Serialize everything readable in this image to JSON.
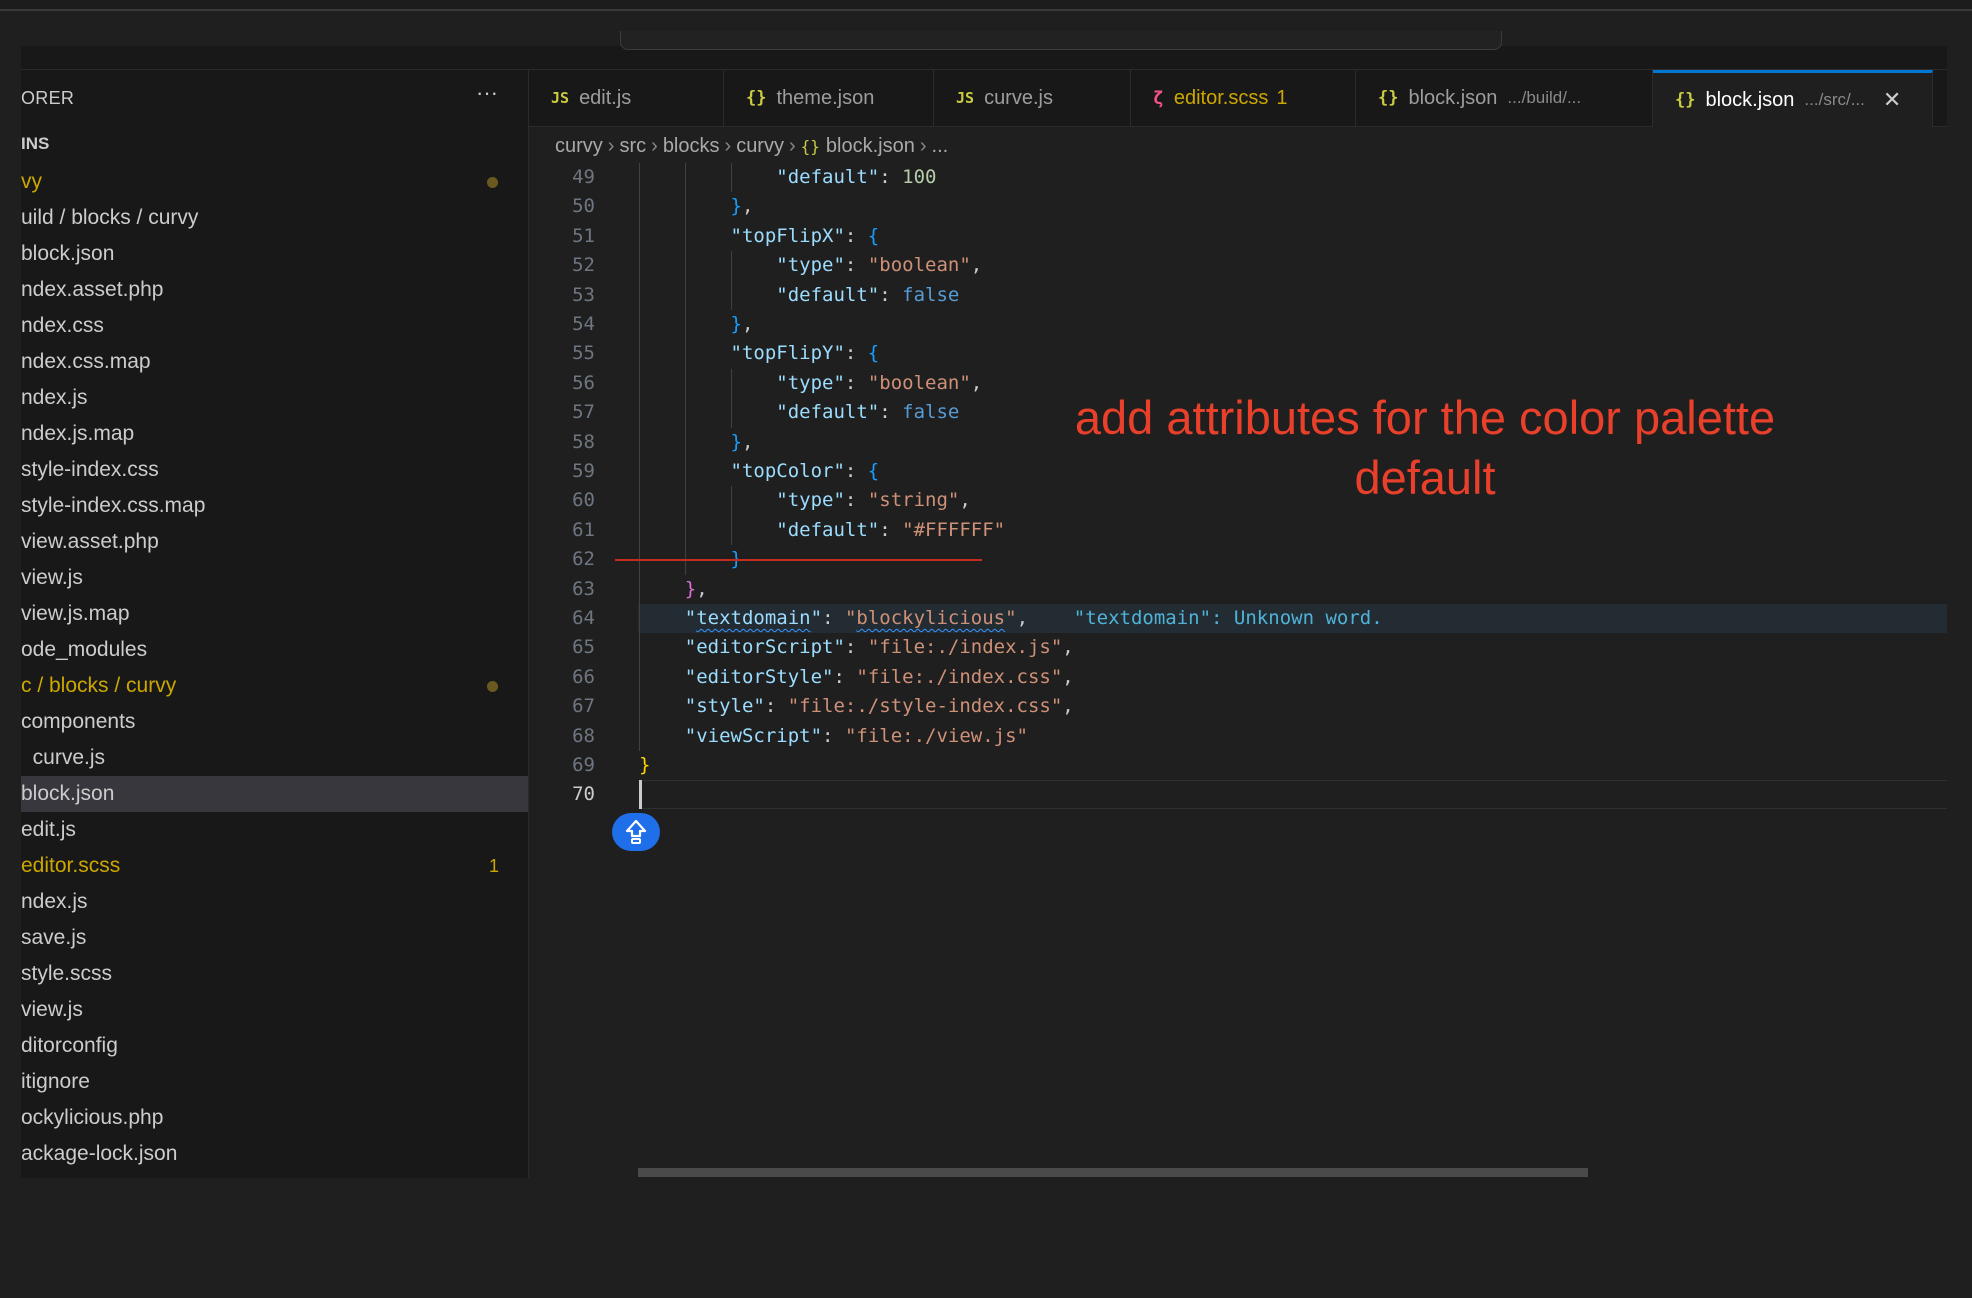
{
  "colors": {
    "accent": "#0078d4",
    "annotation": "#e8402a",
    "modified": "#cca700"
  },
  "sidebar": {
    "title": "ORER",
    "more_icon": "ellipsis-icon",
    "section": "INS",
    "items": [
      {
        "label": "vy",
        "modified": true,
        "dot": true
      },
      {
        "label": "uild / blocks / curvy"
      },
      {
        "label": "block.json"
      },
      {
        "label": "ndex.asset.php"
      },
      {
        "label": "ndex.css"
      },
      {
        "label": "ndex.css.map"
      },
      {
        "label": "ndex.js"
      },
      {
        "label": "ndex.js.map"
      },
      {
        "label": "style-index.css"
      },
      {
        "label": "style-index.css.map"
      },
      {
        "label": "view.asset.php"
      },
      {
        "label": "view.js"
      },
      {
        "label": "view.js.map"
      },
      {
        "label": "ode_modules"
      },
      {
        "label": "c / blocks / curvy",
        "modified": true,
        "dot": true
      },
      {
        "label": "components"
      },
      {
        "label": "  curve.js"
      },
      {
        "label": "block.json",
        "selected": true
      },
      {
        "label": "edit.js"
      },
      {
        "label": "editor.scss",
        "modified": true,
        "badge": "1"
      },
      {
        "label": "ndex.js"
      },
      {
        "label": "save.js"
      },
      {
        "label": "style.scss"
      },
      {
        "label": "view.js"
      },
      {
        "label": "ditorconfig"
      },
      {
        "label": "itignore"
      },
      {
        "label": "ockylicious.php"
      },
      {
        "label": "ackage-lock.json"
      }
    ]
  },
  "tabs": [
    {
      "icon": "JS",
      "kind": "js",
      "label": "edit.js"
    },
    {
      "icon": "{}",
      "kind": "json",
      "label": "theme.json"
    },
    {
      "icon": "JS",
      "kind": "js",
      "label": "curve.js"
    },
    {
      "icon": "sass-icon",
      "kind": "scss",
      "label": "editor.scss",
      "errors": "1"
    },
    {
      "icon": "{}",
      "kind": "json",
      "label": "block.json",
      "desc": ".../build/..."
    },
    {
      "icon": "{}",
      "kind": "json",
      "label": "block.json",
      "desc": ".../src/...",
      "active": true
    }
  ],
  "breadcrumb": [
    "curvy",
    "src",
    "blocks",
    "curvy",
    "block.json",
    "..."
  ],
  "annotation": {
    "line1": "add attributes for the color palette",
    "line2": "default"
  },
  "code": {
    "cursor_line": 70,
    "highlight_line": 64,
    "lines": [
      {
        "n": "49",
        "tokens": [
          [
            "            ",
            "p"
          ],
          [
            "\"default\"",
            "key"
          ],
          [
            ": ",
            "p"
          ],
          [
            "100",
            "num"
          ]
        ]
      },
      {
        "n": "50",
        "tokens": [
          [
            "        ",
            "p"
          ],
          [
            "}",
            "b3"
          ],
          [
            ",",
            "p"
          ]
        ]
      },
      {
        "n": "51",
        "tokens": [
          [
            "        ",
            "p"
          ],
          [
            "\"topFlipX\"",
            "key"
          ],
          [
            ": ",
            "p"
          ],
          [
            "{",
            "b3"
          ]
        ]
      },
      {
        "n": "52",
        "tokens": [
          [
            "            ",
            "p"
          ],
          [
            "\"type\"",
            "key"
          ],
          [
            ": ",
            "p"
          ],
          [
            "\"boolean\"",
            "str"
          ],
          [
            ",",
            "p"
          ]
        ]
      },
      {
        "n": "53",
        "tokens": [
          [
            "            ",
            "p"
          ],
          [
            "\"default\"",
            "key"
          ],
          [
            ": ",
            "p"
          ],
          [
            "false",
            "bool"
          ]
        ]
      },
      {
        "n": "54",
        "tokens": [
          [
            "        ",
            "p"
          ],
          [
            "}",
            "b3"
          ],
          [
            ",",
            "p"
          ]
        ]
      },
      {
        "n": "55",
        "tokens": [
          [
            "        ",
            "p"
          ],
          [
            "\"topFlipY\"",
            "key"
          ],
          [
            ": ",
            "p"
          ],
          [
            "{",
            "b3"
          ]
        ]
      },
      {
        "n": "56",
        "tokens": [
          [
            "            ",
            "p"
          ],
          [
            "\"type\"",
            "key"
          ],
          [
            ": ",
            "p"
          ],
          [
            "\"boolean\"",
            "str"
          ],
          [
            ",",
            "p"
          ]
        ]
      },
      {
        "n": "57",
        "tokens": [
          [
            "            ",
            "p"
          ],
          [
            "\"default\"",
            "key"
          ],
          [
            ": ",
            "p"
          ],
          [
            "false",
            "bool"
          ]
        ]
      },
      {
        "n": "58",
        "tokens": [
          [
            "        ",
            "p"
          ],
          [
            "}",
            "b3"
          ],
          [
            ",",
            "p"
          ]
        ]
      },
      {
        "n": "59",
        "tokens": [
          [
            "        ",
            "p"
          ],
          [
            "\"topColor\"",
            "key"
          ],
          [
            ": ",
            "p"
          ],
          [
            "{",
            "b3"
          ]
        ]
      },
      {
        "n": "60",
        "tokens": [
          [
            "            ",
            "p"
          ],
          [
            "\"type\"",
            "key"
          ],
          [
            ": ",
            "p"
          ],
          [
            "\"string\"",
            "str"
          ],
          [
            ",",
            "p"
          ]
        ]
      },
      {
        "n": "61",
        "tokens": [
          [
            "            ",
            "p"
          ],
          [
            "\"default\"",
            "key"
          ],
          [
            ": ",
            "p"
          ],
          [
            "\"#FFFFFF\"",
            "str"
          ]
        ]
      },
      {
        "n": "62",
        "tokens": [
          [
            "        ",
            "p"
          ],
          [
            "}",
            "b3"
          ]
        ]
      },
      {
        "n": "63",
        "tokens": [
          [
            "    ",
            "p"
          ],
          [
            "}",
            "b2"
          ],
          [
            ",",
            "p"
          ]
        ]
      },
      {
        "n": "64",
        "tokens": [
          [
            "    ",
            "p"
          ],
          [
            "\"",
            "key"
          ],
          [
            "textdomain",
            "key squig"
          ],
          [
            "\"",
            "key"
          ],
          [
            ": ",
            "p"
          ],
          [
            "\"",
            "str"
          ],
          [
            "blockylicious",
            "str squig"
          ],
          [
            "\"",
            "str"
          ],
          [
            ",",
            "p"
          ],
          [
            "    \"textdomain\": Unknown word.",
            "hint"
          ]
        ]
      },
      {
        "n": "65",
        "tokens": [
          [
            "    ",
            "p"
          ],
          [
            "\"editorScript\"",
            "key"
          ],
          [
            ": ",
            "p"
          ],
          [
            "\"file:./index.js\"",
            "str"
          ],
          [
            ",",
            "p"
          ]
        ]
      },
      {
        "n": "66",
        "tokens": [
          [
            "    ",
            "p"
          ],
          [
            "\"editorStyle\"",
            "key"
          ],
          [
            ": ",
            "p"
          ],
          [
            "\"file:./index.css\"",
            "str"
          ],
          [
            ",",
            "p"
          ]
        ]
      },
      {
        "n": "67",
        "tokens": [
          [
            "    ",
            "p"
          ],
          [
            "\"style\"",
            "key"
          ],
          [
            ": ",
            "p"
          ],
          [
            "\"file:./style-index.css\"",
            "str"
          ],
          [
            ",",
            "p"
          ]
        ]
      },
      {
        "n": "68",
        "tokens": [
          [
            "    ",
            "p"
          ],
          [
            "\"viewScript\"",
            "key"
          ],
          [
            ": ",
            "p"
          ],
          [
            "\"file:./view.js\"",
            "str"
          ]
        ]
      },
      {
        "n": "69",
        "tokens": [
          [
            "",
            "p"
          ],
          [
            "}",
            "b1"
          ]
        ]
      },
      {
        "n": "70",
        "tokens": []
      }
    ]
  }
}
